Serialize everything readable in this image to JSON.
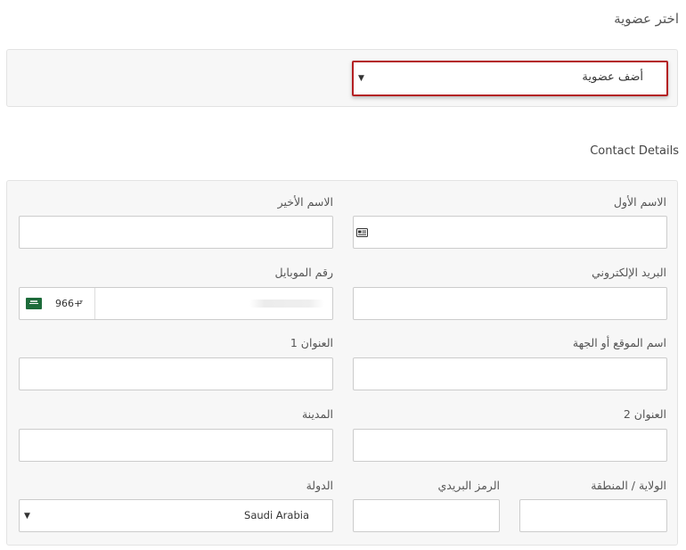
{
  "membership": {
    "title": "اختر عضوية",
    "select_value": "أضف عضوية"
  },
  "contact": {
    "title": "Contact Details",
    "first_name_label": "الاسم الأول",
    "last_name_label": "الاسم الأخير",
    "email_label": "البريد الإلكتروني",
    "mobile_label": "رقم الموبايل",
    "dial_code": "966+",
    "site_label": "اسم الموقع أو الجهة",
    "address1_label": "العنوان 1",
    "address2_label": "العنوان 2",
    "city_label": "المدينة",
    "state_label": "الولاية / المنطقة",
    "postal_label": "الرمز البريدي",
    "country_label": "الدولة",
    "country_value": "Saudi Arabia"
  },
  "icons": {
    "first_name_field_icon": "id-card-icon",
    "select_caret": "caret-down-icon",
    "phone_flag": "saudi-arabia-flag-icon"
  }
}
